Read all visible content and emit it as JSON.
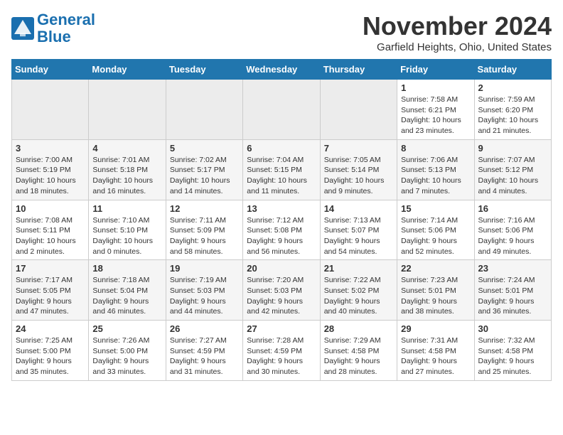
{
  "header": {
    "logo_line1": "General",
    "logo_line2": "Blue",
    "month": "November 2024",
    "location": "Garfield Heights, Ohio, United States"
  },
  "weekdays": [
    "Sunday",
    "Monday",
    "Tuesday",
    "Wednesday",
    "Thursday",
    "Friday",
    "Saturday"
  ],
  "weeks": [
    [
      {
        "day": "",
        "info": ""
      },
      {
        "day": "",
        "info": ""
      },
      {
        "day": "",
        "info": ""
      },
      {
        "day": "",
        "info": ""
      },
      {
        "day": "",
        "info": ""
      },
      {
        "day": "1",
        "info": "Sunrise: 7:58 AM\nSunset: 6:21 PM\nDaylight: 10 hours and 23 minutes."
      },
      {
        "day": "2",
        "info": "Sunrise: 7:59 AM\nSunset: 6:20 PM\nDaylight: 10 hours and 21 minutes."
      }
    ],
    [
      {
        "day": "3",
        "info": "Sunrise: 7:00 AM\nSunset: 5:19 PM\nDaylight: 10 hours and 18 minutes."
      },
      {
        "day": "4",
        "info": "Sunrise: 7:01 AM\nSunset: 5:18 PM\nDaylight: 10 hours and 16 minutes."
      },
      {
        "day": "5",
        "info": "Sunrise: 7:02 AM\nSunset: 5:17 PM\nDaylight: 10 hours and 14 minutes."
      },
      {
        "day": "6",
        "info": "Sunrise: 7:04 AM\nSunset: 5:15 PM\nDaylight: 10 hours and 11 minutes."
      },
      {
        "day": "7",
        "info": "Sunrise: 7:05 AM\nSunset: 5:14 PM\nDaylight: 10 hours and 9 minutes."
      },
      {
        "day": "8",
        "info": "Sunrise: 7:06 AM\nSunset: 5:13 PM\nDaylight: 10 hours and 7 minutes."
      },
      {
        "day": "9",
        "info": "Sunrise: 7:07 AM\nSunset: 5:12 PM\nDaylight: 10 hours and 4 minutes."
      }
    ],
    [
      {
        "day": "10",
        "info": "Sunrise: 7:08 AM\nSunset: 5:11 PM\nDaylight: 10 hours and 2 minutes."
      },
      {
        "day": "11",
        "info": "Sunrise: 7:10 AM\nSunset: 5:10 PM\nDaylight: 10 hours and 0 minutes."
      },
      {
        "day": "12",
        "info": "Sunrise: 7:11 AM\nSunset: 5:09 PM\nDaylight: 9 hours and 58 minutes."
      },
      {
        "day": "13",
        "info": "Sunrise: 7:12 AM\nSunset: 5:08 PM\nDaylight: 9 hours and 56 minutes."
      },
      {
        "day": "14",
        "info": "Sunrise: 7:13 AM\nSunset: 5:07 PM\nDaylight: 9 hours and 54 minutes."
      },
      {
        "day": "15",
        "info": "Sunrise: 7:14 AM\nSunset: 5:06 PM\nDaylight: 9 hours and 52 minutes."
      },
      {
        "day": "16",
        "info": "Sunrise: 7:16 AM\nSunset: 5:06 PM\nDaylight: 9 hours and 49 minutes."
      }
    ],
    [
      {
        "day": "17",
        "info": "Sunrise: 7:17 AM\nSunset: 5:05 PM\nDaylight: 9 hours and 47 minutes."
      },
      {
        "day": "18",
        "info": "Sunrise: 7:18 AM\nSunset: 5:04 PM\nDaylight: 9 hours and 46 minutes."
      },
      {
        "day": "19",
        "info": "Sunrise: 7:19 AM\nSunset: 5:03 PM\nDaylight: 9 hours and 44 minutes."
      },
      {
        "day": "20",
        "info": "Sunrise: 7:20 AM\nSunset: 5:03 PM\nDaylight: 9 hours and 42 minutes."
      },
      {
        "day": "21",
        "info": "Sunrise: 7:22 AM\nSunset: 5:02 PM\nDaylight: 9 hours and 40 minutes."
      },
      {
        "day": "22",
        "info": "Sunrise: 7:23 AM\nSunset: 5:01 PM\nDaylight: 9 hours and 38 minutes."
      },
      {
        "day": "23",
        "info": "Sunrise: 7:24 AM\nSunset: 5:01 PM\nDaylight: 9 hours and 36 minutes."
      }
    ],
    [
      {
        "day": "24",
        "info": "Sunrise: 7:25 AM\nSunset: 5:00 PM\nDaylight: 9 hours and 35 minutes."
      },
      {
        "day": "25",
        "info": "Sunrise: 7:26 AM\nSunset: 5:00 PM\nDaylight: 9 hours and 33 minutes."
      },
      {
        "day": "26",
        "info": "Sunrise: 7:27 AM\nSunset: 4:59 PM\nDaylight: 9 hours and 31 minutes."
      },
      {
        "day": "27",
        "info": "Sunrise: 7:28 AM\nSunset: 4:59 PM\nDaylight: 9 hours and 30 minutes."
      },
      {
        "day": "28",
        "info": "Sunrise: 7:29 AM\nSunset: 4:58 PM\nDaylight: 9 hours and 28 minutes."
      },
      {
        "day": "29",
        "info": "Sunrise: 7:31 AM\nSunset: 4:58 PM\nDaylight: 9 hours and 27 minutes."
      },
      {
        "day": "30",
        "info": "Sunrise: 7:32 AM\nSunset: 4:58 PM\nDaylight: 9 hours and 25 minutes."
      }
    ]
  ]
}
